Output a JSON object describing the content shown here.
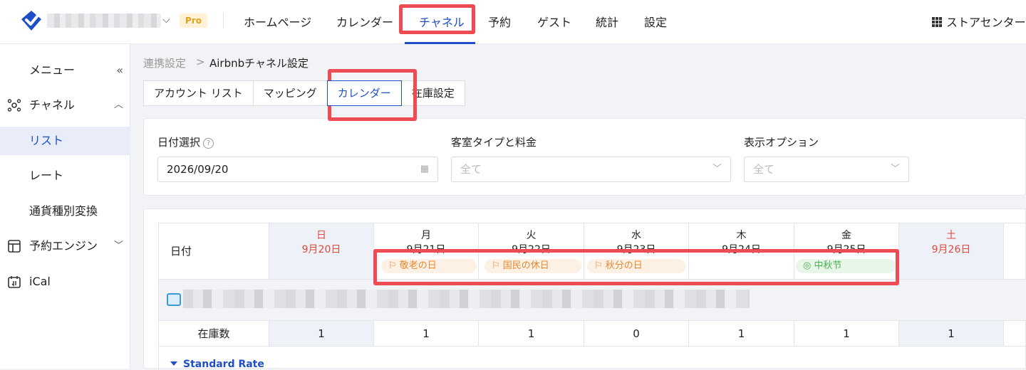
{
  "header": {
    "pro_badge": "Pro",
    "nav": [
      {
        "label": "ホームページ"
      },
      {
        "label": "カレンダー"
      },
      {
        "label": "チャネル",
        "active": true
      },
      {
        "label": "予約"
      },
      {
        "label": "ゲスト"
      },
      {
        "label": "統計"
      },
      {
        "label": "設定"
      }
    ],
    "store_center": "ストアセンター",
    "accent_color": "#1f4fc8"
  },
  "sidebar": {
    "menu_label": "メニュー",
    "collapse_icon": "«",
    "items": [
      {
        "label": "チャネル",
        "icon": "channel-icon",
        "expanded": true
      },
      {
        "label": "リスト",
        "selected": true
      },
      {
        "label": "レート"
      },
      {
        "label": "通貨種別変換"
      },
      {
        "label": "予約エンジン",
        "icon": "layout-icon"
      },
      {
        "label": "iCal",
        "icon": "calendar-sync-icon"
      }
    ]
  },
  "breadcrumb": {
    "parent": "連携設定",
    "separator": ">",
    "current": "Airbnbチャネル設定"
  },
  "tabs": [
    {
      "label": "アカウント リスト"
    },
    {
      "label": "マッピング"
    },
    {
      "label": "カレンダー",
      "active": true
    },
    {
      "label": "在庫設定"
    }
  ],
  "filters": {
    "date_label": "日付選択",
    "date_help": "?",
    "date_value": "2026/09/20",
    "room_label": "客室タイプと料金",
    "room_placeholder": "全て",
    "display_label": "表示オプション",
    "display_placeholder": "全て"
  },
  "calendar": {
    "date_header": "日付",
    "days": [
      {
        "weekday": "日",
        "date": "9月20日",
        "weekend": true,
        "inventory": "1"
      },
      {
        "weekday": "月",
        "date": "9月21日",
        "holiday": "敬老の日",
        "holiday_type": "jp",
        "inventory": "1"
      },
      {
        "weekday": "火",
        "date": "9月22日",
        "holiday": "国民の休日",
        "holiday_type": "jp",
        "inventory": "1"
      },
      {
        "weekday": "水",
        "date": "9月23日",
        "holiday": "秋分の日",
        "holiday_type": "jp",
        "inventory": "0"
      },
      {
        "weekday": "木",
        "date": "9月24日",
        "inventory": "1"
      },
      {
        "weekday": "金",
        "date": "9月25日",
        "holiday": "中秋节",
        "holiday_type": "cn",
        "inventory": "1"
      },
      {
        "weekday": "土",
        "date": "9月26日",
        "weekend": true,
        "inventory": "1"
      }
    ],
    "inventory_label": "在庫数",
    "rate_plan": "Standard Rate"
  }
}
